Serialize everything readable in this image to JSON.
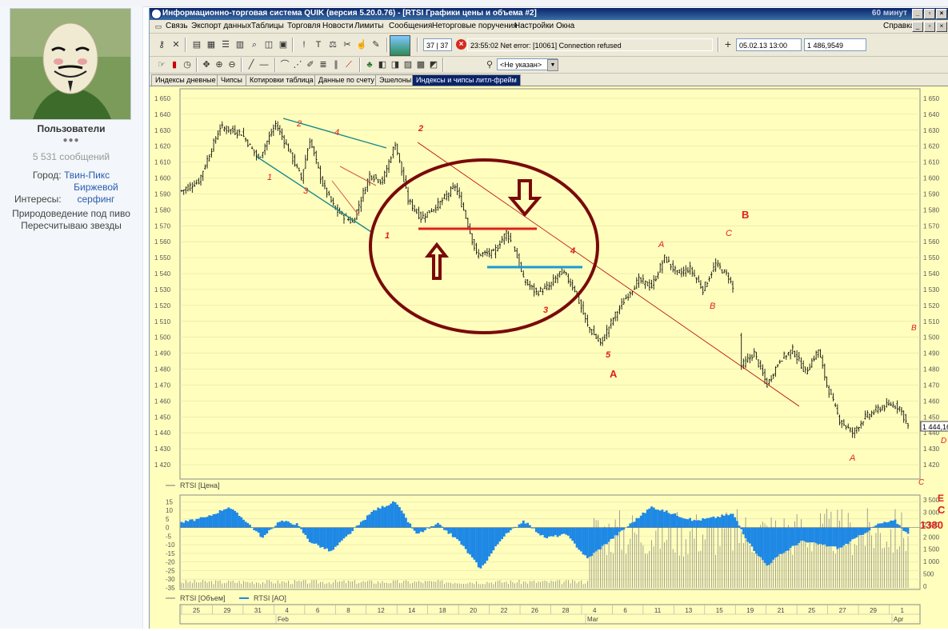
{
  "forum": {
    "username": "Пользователи",
    "rank_dots": "●●●",
    "post_count": "5 531 сообщений",
    "city_label": "Город:",
    "city": "Твин-Пикс",
    "interests_label": "Интересы:",
    "interests": "Биржевой серфинг",
    "hobby": "Природоведение под пиво",
    "stars": "Пересчитываю звезды"
  },
  "window": {
    "title": "Информационно-торговая система QUIK (версия 5.20.0.76) - [RTSI Графики цены и объема #2]",
    "timeframe": "60 минут",
    "menu": [
      "Связь",
      "Экспорт данных",
      "Таблицы",
      "Торговля",
      "Новости",
      "Лимиты",
      "Сообщения",
      "Неторговые поручения",
      "Настройки",
      "Окна"
    ],
    "help_menu": "Справка",
    "counter": "37 | 37",
    "status_message": "23:55:02  Net error: [10061] Connection refused",
    "cursor_date": "05.02.13 13:00",
    "cursor_value": "1 486,9549",
    "account_select": "<Не указан>",
    "tabs": [
      "Индексы дневные",
      "Чипсы",
      "Котировки таблица",
      "Данные по счету",
      "Эшелоны",
      "Индексы и чипсы литл-фрейм"
    ],
    "active_tab": 5
  },
  "chart_data": [
    {
      "type": "candlestick",
      "legend": "RTSI [Цена]",
      "ylim": [
        1412,
        1655
      ],
      "yticks": [
        1420,
        1430,
        1440,
        1450,
        1460,
        1470,
        1480,
        1490,
        1500,
        1510,
        1520,
        1530,
        1540,
        1550,
        1560,
        1570,
        1580,
        1590,
        1600,
        1610,
        1620,
        1630,
        1640,
        1650
      ],
      "last_value_label": "1 444,16",
      "key_points": [
        {
          "bar": 0,
          "price": 1592
        },
        {
          "bar": 8,
          "price": 1598
        },
        {
          "bar": 18,
          "price": 1632
        },
        {
          "bar": 28,
          "price": 1628
        },
        {
          "bar": 36,
          "price": 1612
        },
        {
          "bar": 44,
          "price": 1634
        },
        {
          "bar": 50,
          "price": 1618
        },
        {
          "bar": 56,
          "price": 1600
        },
        {
          "bar": 60,
          "price": 1624
        },
        {
          "bar": 66,
          "price": 1596
        },
        {
          "bar": 72,
          "price": 1580
        },
        {
          "bar": 80,
          "price": 1572
        },
        {
          "bar": 88,
          "price": 1602
        },
        {
          "bar": 94,
          "price": 1598
        },
        {
          "bar": 100,
          "price": 1622
        },
        {
          "bar": 106,
          "price": 1586
        },
        {
          "bar": 112,
          "price": 1575
        },
        {
          "bar": 120,
          "price": 1583
        },
        {
          "bar": 128,
          "price": 1595
        },
        {
          "bar": 132,
          "price": 1580
        },
        {
          "bar": 138,
          "price": 1552
        },
        {
          "bar": 146,
          "price": 1553
        },
        {
          "bar": 152,
          "price": 1566
        },
        {
          "bar": 156,
          "price": 1555
        },
        {
          "bar": 160,
          "price": 1536
        },
        {
          "bar": 166,
          "price": 1528
        },
        {
          "bar": 172,
          "price": 1532
        },
        {
          "bar": 178,
          "price": 1542
        },
        {
          "bar": 184,
          "price": 1530
        },
        {
          "bar": 190,
          "price": 1507
        },
        {
          "bar": 196,
          "price": 1496
        },
        {
          "bar": 202,
          "price": 1512
        },
        {
          "bar": 208,
          "price": 1525
        },
        {
          "bar": 214,
          "price": 1536
        },
        {
          "bar": 220,
          "price": 1532
        },
        {
          "bar": 226,
          "price": 1550
        },
        {
          "bar": 232,
          "price": 1540
        },
        {
          "bar": 238,
          "price": 1543
        },
        {
          "bar": 244,
          "price": 1530
        },
        {
          "bar": 250,
          "price": 1546
        },
        {
          "bar": 256,
          "price": 1538
        },
        {
          "bar": 260,
          "price": 1523
        },
        {
          "bar": 262,
          "price": 1482
        },
        {
          "bar": 268,
          "price": 1490
        },
        {
          "bar": 274,
          "price": 1470
        },
        {
          "bar": 280,
          "price": 1486
        },
        {
          "bar": 286,
          "price": 1492
        },
        {
          "bar": 292,
          "price": 1478
        },
        {
          "bar": 298,
          "price": 1492
        },
        {
          "bar": 302,
          "price": 1470
        },
        {
          "bar": 308,
          "price": 1448
        },
        {
          "bar": 314,
          "price": 1440
        },
        {
          "bar": 320,
          "price": 1450
        },
        {
          "bar": 326,
          "price": 1455
        },
        {
          "bar": 332,
          "price": 1458
        },
        {
          "bar": 336,
          "price": 1456
        },
        {
          "bar": 340,
          "price": 1444
        }
      ],
      "annotations": [
        "1",
        "2",
        "3",
        "4",
        "1",
        "2",
        "3",
        "4",
        "5",
        "A",
        "A",
        "B",
        "C",
        "B",
        "A",
        "B",
        "C",
        "D",
        "E",
        "C"
      ]
    },
    {
      "type": "histogram",
      "legend": [
        "RTSI [Объем]",
        "RTSI [AO]"
      ],
      "ylim": [
        -35,
        17
      ],
      "yticks_left": [
        15,
        10,
        5,
        0,
        -5,
        -10,
        -15,
        -20,
        -25,
        -30,
        -35
      ],
      "yticks_right": [
        "3 500",
        "3 000",
        "2 500",
        "2 000",
        "1 500",
        "1 000",
        "500",
        "0"
      ],
      "ao_key_points": [
        {
          "bar": 0,
          "v": 3
        },
        {
          "bar": 12,
          "v": 6
        },
        {
          "bar": 22,
          "v": 12
        },
        {
          "bar": 30,
          "v": 4
        },
        {
          "bar": 38,
          "v": -6
        },
        {
          "bar": 46,
          "v": 4
        },
        {
          "bar": 54,
          "v": 2
        },
        {
          "bar": 60,
          "v": -8
        },
        {
          "bar": 70,
          "v": -14
        },
        {
          "bar": 80,
          "v": -2
        },
        {
          "bar": 90,
          "v": 10
        },
        {
          "bar": 100,
          "v": 15
        },
        {
          "bar": 110,
          "v": -4
        },
        {
          "bar": 120,
          "v": 2
        },
        {
          "bar": 130,
          "v": -8
        },
        {
          "bar": 140,
          "v": -24
        },
        {
          "bar": 150,
          "v": -6
        },
        {
          "bar": 160,
          "v": 4
        },
        {
          "bar": 170,
          "v": -6
        },
        {
          "bar": 180,
          "v": -4
        },
        {
          "bar": 190,
          "v": -18
        },
        {
          "bar": 200,
          "v": -8
        },
        {
          "bar": 210,
          "v": 2
        },
        {
          "bar": 220,
          "v": 12
        },
        {
          "bar": 230,
          "v": 8
        },
        {
          "bar": 240,
          "v": 4
        },
        {
          "bar": 250,
          "v": 6
        },
        {
          "bar": 258,
          "v": 8
        },
        {
          "bar": 266,
          "v": -10
        },
        {
          "bar": 274,
          "v": -22
        },
        {
          "bar": 280,
          "v": -16
        },
        {
          "bar": 290,
          "v": -8
        },
        {
          "bar": 300,
          "v": -10
        },
        {
          "bar": 308,
          "v": -12
        },
        {
          "bar": 316,
          "v": -6
        },
        {
          "bar": 326,
          "v": 2
        },
        {
          "bar": 334,
          "v": 4
        },
        {
          "bar": 340,
          "v": -4
        }
      ],
      "side_label": "1380"
    }
  ],
  "time_axis": {
    "days": [
      "25",
      "29",
      "31",
      "4",
      "6",
      "8",
      "12",
      "14",
      "18",
      "20",
      "22",
      "26",
      "28",
      "4",
      "6",
      "11",
      "13",
      "15",
      "19",
      "21",
      "25",
      "27",
      "29",
      "1"
    ],
    "months": [
      "Feb",
      "Mar",
      "Apr"
    ]
  }
}
